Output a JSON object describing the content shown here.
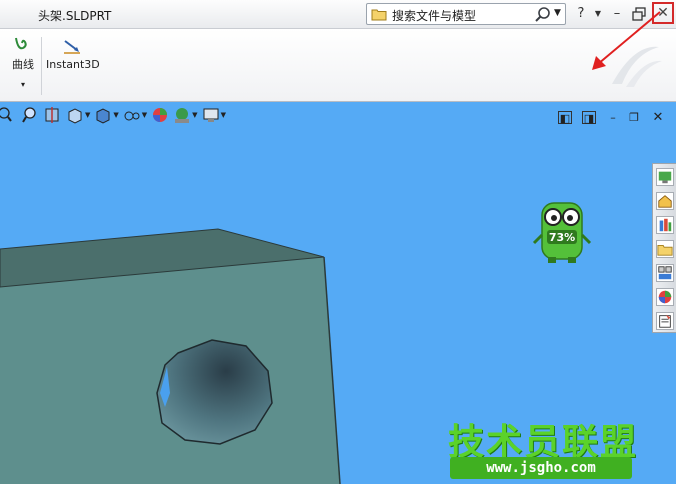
{
  "window": {
    "title": "头架.SLDPRT"
  },
  "search": {
    "placeholder": "搜索文件与模型"
  },
  "titlebar": {
    "help_label": "?",
    "close_label": "✕"
  },
  "ribbon": {
    "items": [
      {
        "label": "曲线",
        "icon": "curve-icon"
      },
      {
        "label": "Instant3D",
        "icon": "instant3d-icon"
      }
    ],
    "dropdown_label": "▾"
  },
  "mascot": {
    "progress_text": "73%",
    "progress": 0.73
  },
  "watermark": {
    "title": "技术员联盟",
    "url": "www.jsgho.com"
  },
  "colors": {
    "viewport_bg": "#55aaf5",
    "part_face": "#5e8f8d",
    "close_highlight": "#d42a2a",
    "arrow": "#e02020",
    "watermark_green": "#5bd22a"
  }
}
